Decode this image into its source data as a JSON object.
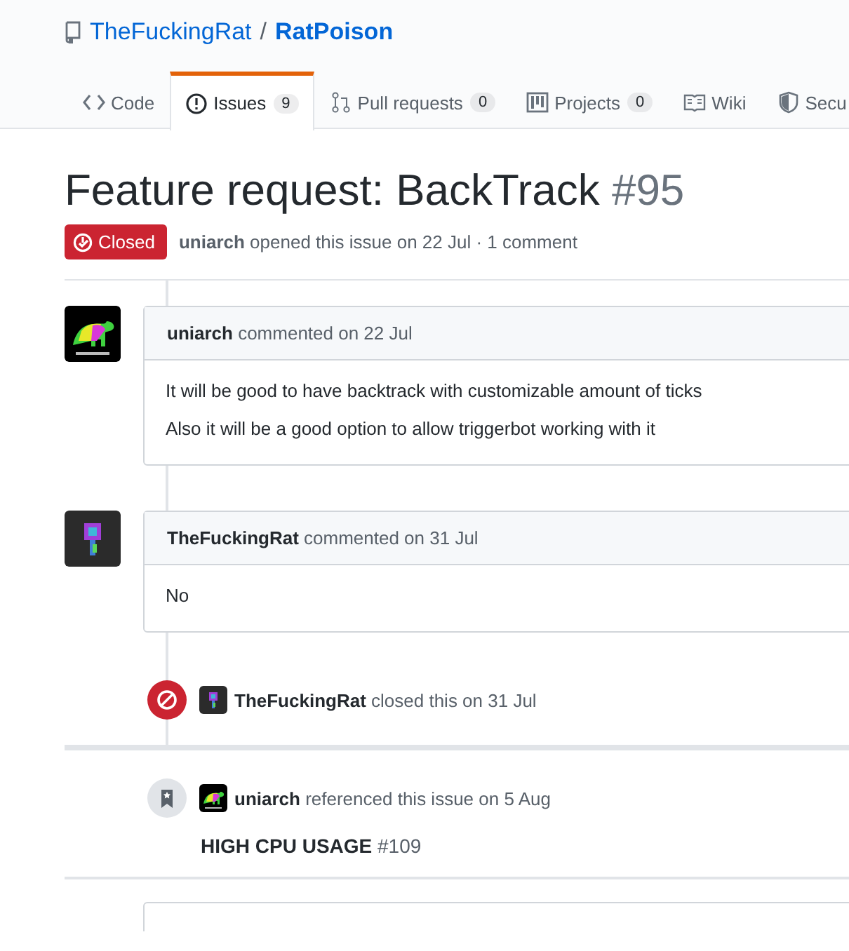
{
  "repo": {
    "owner": "TheFuckingRat",
    "separator": "/",
    "name": "RatPoison"
  },
  "tabs": [
    {
      "label": "Code",
      "selected": false
    },
    {
      "label": "Issues",
      "count": "9",
      "selected": true
    },
    {
      "label": "Pull requests",
      "count": "0",
      "selected": false
    },
    {
      "label": "Projects",
      "count": "0",
      "selected": false
    },
    {
      "label": "Wiki",
      "selected": false
    },
    {
      "label": "Secu",
      "selected": false
    }
  ],
  "issue": {
    "title": "Feature request: BackTrack",
    "number": "#95",
    "state": "Closed",
    "author": "uniarch",
    "meta": "opened this issue on 22 Jul · 1 comment"
  },
  "timeline": [
    {
      "kind": "comment",
      "author": "uniarch",
      "action": "commented on 22 Jul",
      "paragraphs": [
        "It will be good to have backtrack with customizable amount of ticks",
        "Also it will be a good option to allow triggerbot working with it"
      ]
    },
    {
      "kind": "comment",
      "author": "TheFuckingRat",
      "action": "commented on 31 Jul",
      "paragraphs": [
        "No"
      ]
    },
    {
      "kind": "closed",
      "author": "TheFuckingRat",
      "action": "closed this on 31 Jul"
    },
    {
      "kind": "reference",
      "author": "uniarch",
      "action": "referenced this issue on 5 Aug",
      "ref_title": "HIGH CPU USAGE",
      "ref_number": "#109"
    }
  ]
}
